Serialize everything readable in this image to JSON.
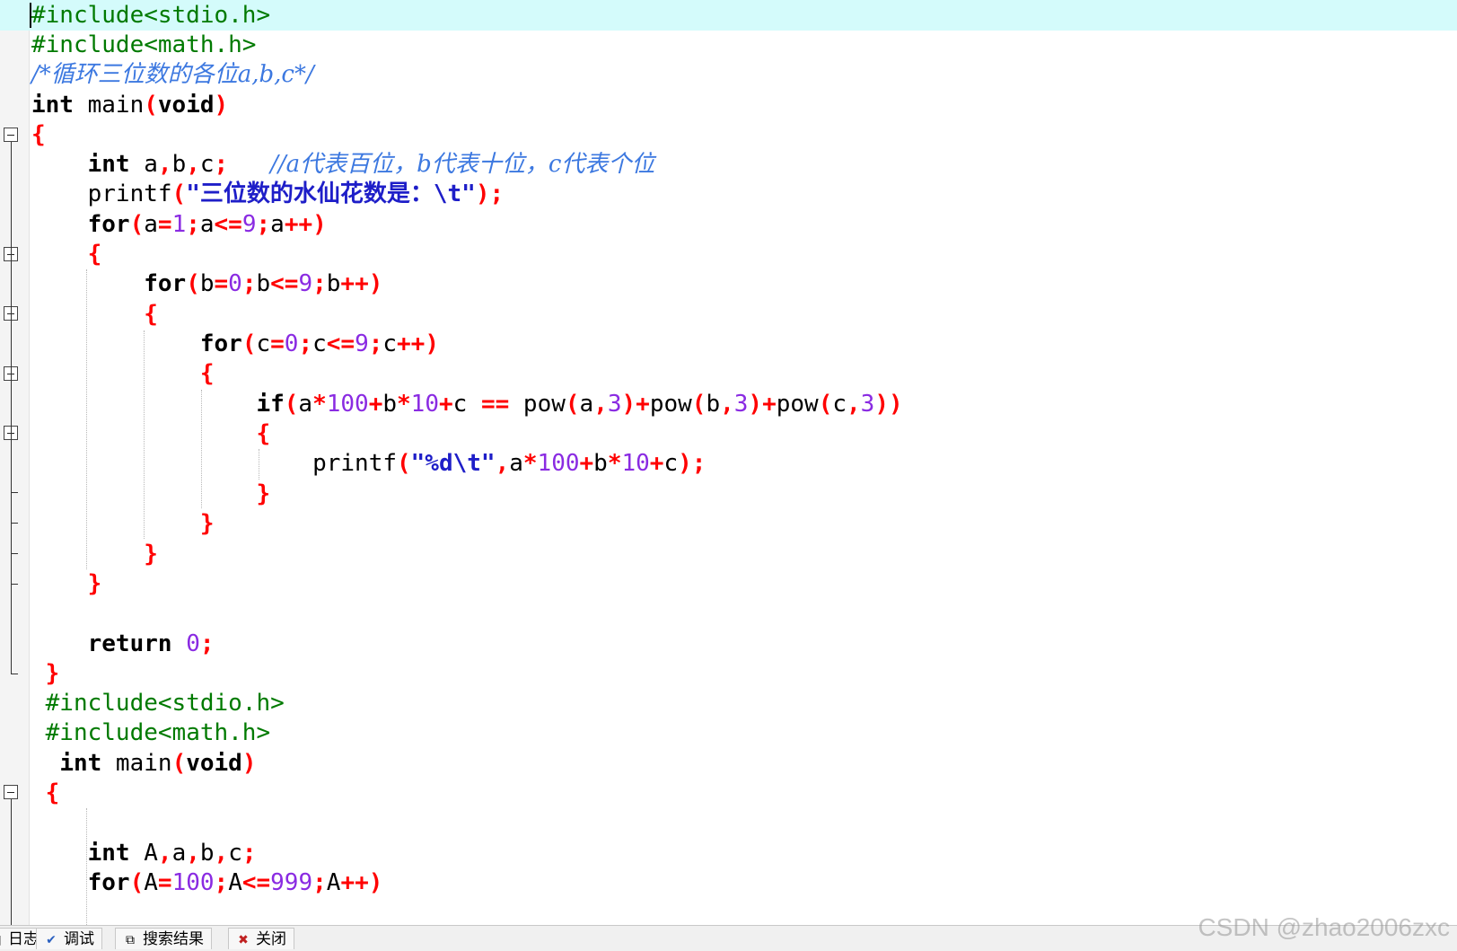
{
  "colors": {
    "preprocessor": "#007a00",
    "keyword": "#000000",
    "comment": "#3c78e0",
    "string": "#1e1ec8",
    "number": "#8a2be2",
    "operator": "#ff0000",
    "current_line": "#d4fbfb"
  },
  "editor": {
    "current_line_index": 0,
    "lines": [
      {
        "tokens": [
          {
            "t": "#include<stdio.h>",
            "c": "pp"
          }
        ]
      },
      {
        "tokens": [
          {
            "t": "#include<math.h>",
            "c": "pp"
          }
        ]
      },
      {
        "tokens": [
          {
            "t": "/*循环三位数的各位a,b,c*/",
            "c": "cm"
          }
        ]
      },
      {
        "tokens": [
          {
            "t": "int",
            "c": "kw"
          },
          {
            "t": " main",
            "c": "id"
          },
          {
            "t": "(",
            "c": "op"
          },
          {
            "t": "void",
            "c": "kw"
          },
          {
            "t": ")",
            "c": "op"
          }
        ]
      },
      {
        "tokens": [
          {
            "t": "{",
            "c": "op"
          }
        ]
      },
      {
        "tokens": [
          {
            "t": "    ",
            "c": "ws"
          },
          {
            "t": "int",
            "c": "kw"
          },
          {
            "t": " a",
            "c": "id"
          },
          {
            "t": ",",
            "c": "op"
          },
          {
            "t": "b",
            "c": "id"
          },
          {
            "t": ",",
            "c": "op"
          },
          {
            "t": "c",
            "c": "id"
          },
          {
            "t": ";",
            "c": "op"
          },
          {
            "t": "   ",
            "c": "ws"
          },
          {
            "t": "//a代表百位，b代表十位，c代表个位",
            "c": "cm"
          }
        ]
      },
      {
        "tokens": [
          {
            "t": "    ",
            "c": "ws"
          },
          {
            "t": "printf",
            "c": "id"
          },
          {
            "t": "(",
            "c": "op"
          },
          {
            "t": "\"三位数的水仙花数是：\\t\"",
            "c": "str"
          },
          {
            "t": ");",
            "c": "op"
          }
        ]
      },
      {
        "tokens": [
          {
            "t": "    ",
            "c": "ws"
          },
          {
            "t": "for",
            "c": "kw"
          },
          {
            "t": "(",
            "c": "op"
          },
          {
            "t": "a",
            "c": "id"
          },
          {
            "t": "=",
            "c": "op"
          },
          {
            "t": "1",
            "c": "num"
          },
          {
            "t": ";",
            "c": "op"
          },
          {
            "t": "a",
            "c": "id"
          },
          {
            "t": "<=",
            "c": "op"
          },
          {
            "t": "9",
            "c": "num"
          },
          {
            "t": ";",
            "c": "op"
          },
          {
            "t": "a",
            "c": "id"
          },
          {
            "t": "++)",
            "c": "op"
          }
        ]
      },
      {
        "tokens": [
          {
            "t": "    ",
            "c": "ws"
          },
          {
            "t": "{",
            "c": "op"
          }
        ]
      },
      {
        "tokens": [
          {
            "t": "        ",
            "c": "ws"
          },
          {
            "t": "for",
            "c": "kw"
          },
          {
            "t": "(",
            "c": "op"
          },
          {
            "t": "b",
            "c": "id"
          },
          {
            "t": "=",
            "c": "op"
          },
          {
            "t": "0",
            "c": "num"
          },
          {
            "t": ";",
            "c": "op"
          },
          {
            "t": "b",
            "c": "id"
          },
          {
            "t": "<=",
            "c": "op"
          },
          {
            "t": "9",
            "c": "num"
          },
          {
            "t": ";",
            "c": "op"
          },
          {
            "t": "b",
            "c": "id"
          },
          {
            "t": "++)",
            "c": "op"
          }
        ]
      },
      {
        "tokens": [
          {
            "t": "        ",
            "c": "ws"
          },
          {
            "t": "{",
            "c": "op"
          }
        ]
      },
      {
        "tokens": [
          {
            "t": "            ",
            "c": "ws"
          },
          {
            "t": "for",
            "c": "kw"
          },
          {
            "t": "(",
            "c": "op"
          },
          {
            "t": "c",
            "c": "id"
          },
          {
            "t": "=",
            "c": "op"
          },
          {
            "t": "0",
            "c": "num"
          },
          {
            "t": ";",
            "c": "op"
          },
          {
            "t": "c",
            "c": "id"
          },
          {
            "t": "<=",
            "c": "op"
          },
          {
            "t": "9",
            "c": "num"
          },
          {
            "t": ";",
            "c": "op"
          },
          {
            "t": "c",
            "c": "id"
          },
          {
            "t": "++)",
            "c": "op"
          }
        ]
      },
      {
        "tokens": [
          {
            "t": "            ",
            "c": "ws"
          },
          {
            "t": "{",
            "c": "op"
          }
        ]
      },
      {
        "tokens": [
          {
            "t": "                ",
            "c": "ws"
          },
          {
            "t": "if",
            "c": "kw"
          },
          {
            "t": "(",
            "c": "op"
          },
          {
            "t": "a",
            "c": "id"
          },
          {
            "t": "*",
            "c": "op"
          },
          {
            "t": "100",
            "c": "num"
          },
          {
            "t": "+",
            "c": "op"
          },
          {
            "t": "b",
            "c": "id"
          },
          {
            "t": "*",
            "c": "op"
          },
          {
            "t": "10",
            "c": "num"
          },
          {
            "t": "+",
            "c": "op"
          },
          {
            "t": "c ",
            "c": "id"
          },
          {
            "t": "==",
            "c": "op"
          },
          {
            "t": " pow",
            "c": "id"
          },
          {
            "t": "(",
            "c": "op"
          },
          {
            "t": "a",
            "c": "id"
          },
          {
            "t": ",",
            "c": "op"
          },
          {
            "t": "3",
            "c": "num"
          },
          {
            "t": ")+",
            "c": "op"
          },
          {
            "t": "pow",
            "c": "id"
          },
          {
            "t": "(",
            "c": "op"
          },
          {
            "t": "b",
            "c": "id"
          },
          {
            "t": ",",
            "c": "op"
          },
          {
            "t": "3",
            "c": "num"
          },
          {
            "t": ")+",
            "c": "op"
          },
          {
            "t": "pow",
            "c": "id"
          },
          {
            "t": "(",
            "c": "op"
          },
          {
            "t": "c",
            "c": "id"
          },
          {
            "t": ",",
            "c": "op"
          },
          {
            "t": "3",
            "c": "num"
          },
          {
            "t": "))",
            "c": "op"
          }
        ]
      },
      {
        "tokens": [
          {
            "t": "                ",
            "c": "ws"
          },
          {
            "t": "{",
            "c": "op"
          }
        ]
      },
      {
        "tokens": [
          {
            "t": "                    ",
            "c": "ws"
          },
          {
            "t": "printf",
            "c": "id"
          },
          {
            "t": "(",
            "c": "op"
          },
          {
            "t": "\"%d\\t\"",
            "c": "str"
          },
          {
            "t": ",",
            "c": "op"
          },
          {
            "t": "a",
            "c": "id"
          },
          {
            "t": "*",
            "c": "op"
          },
          {
            "t": "100",
            "c": "num"
          },
          {
            "t": "+",
            "c": "op"
          },
          {
            "t": "b",
            "c": "id"
          },
          {
            "t": "*",
            "c": "op"
          },
          {
            "t": "10",
            "c": "num"
          },
          {
            "t": "+",
            "c": "op"
          },
          {
            "t": "c",
            "c": "id"
          },
          {
            "t": ");",
            "c": "op"
          }
        ]
      },
      {
        "tokens": [
          {
            "t": "                ",
            "c": "ws"
          },
          {
            "t": "}",
            "c": "op"
          }
        ]
      },
      {
        "tokens": [
          {
            "t": "            ",
            "c": "ws"
          },
          {
            "t": "}",
            "c": "op"
          }
        ]
      },
      {
        "tokens": [
          {
            "t": "        ",
            "c": "ws"
          },
          {
            "t": "}",
            "c": "op"
          }
        ]
      },
      {
        "tokens": [
          {
            "t": "    ",
            "c": "ws"
          },
          {
            "t": "}",
            "c": "op"
          }
        ]
      },
      {
        "tokens": []
      },
      {
        "tokens": [
          {
            "t": "    ",
            "c": "ws"
          },
          {
            "t": "return",
            "c": "kw"
          },
          {
            "t": " ",
            "c": "ws"
          },
          {
            "t": "0",
            "c": "num"
          },
          {
            "t": ";",
            "c": "op"
          }
        ]
      },
      {
        "tokens": [
          {
            "t": " ",
            "c": "ws"
          },
          {
            "t": "}",
            "c": "op"
          }
        ]
      },
      {
        "tokens": [
          {
            "t": " ",
            "c": "ws"
          },
          {
            "t": "#include<stdio.h>",
            "c": "pp"
          }
        ]
      },
      {
        "tokens": [
          {
            "t": " ",
            "c": "ws"
          },
          {
            "t": "#include<math.h>",
            "c": "pp"
          }
        ]
      },
      {
        "tokens": [
          {
            "t": "  ",
            "c": "ws"
          },
          {
            "t": "int",
            "c": "kw"
          },
          {
            "t": " main",
            "c": "id"
          },
          {
            "t": "(",
            "c": "op"
          },
          {
            "t": "void",
            "c": "kw"
          },
          {
            "t": ")",
            "c": "op"
          }
        ]
      },
      {
        "tokens": [
          {
            "t": " ",
            "c": "ws"
          },
          {
            "t": "{",
            "c": "op"
          }
        ]
      },
      {
        "tokens": []
      },
      {
        "tokens": [
          {
            "t": "    ",
            "c": "ws"
          },
          {
            "t": "int",
            "c": "kw"
          },
          {
            "t": " A",
            "c": "id"
          },
          {
            "t": ",",
            "c": "op"
          },
          {
            "t": "a",
            "c": "id"
          },
          {
            "t": ",",
            "c": "op"
          },
          {
            "t": "b",
            "c": "id"
          },
          {
            "t": ",",
            "c": "op"
          },
          {
            "t": "c",
            "c": "id"
          },
          {
            "t": ";",
            "c": "op"
          }
        ]
      },
      {
        "tokens": [
          {
            "t": "    ",
            "c": "ws"
          },
          {
            "t": "for",
            "c": "kw"
          },
          {
            "t": "(",
            "c": "op"
          },
          {
            "t": "A",
            "c": "id"
          },
          {
            "t": "=",
            "c": "op"
          },
          {
            "t": "100",
            "c": "num"
          },
          {
            "t": ";",
            "c": "op"
          },
          {
            "t": "A",
            "c": "id"
          },
          {
            "t": "<=",
            "c": "op"
          },
          {
            "t": "999",
            "c": "num"
          },
          {
            "t": ";",
            "c": "op"
          },
          {
            "t": "A",
            "c": "id"
          },
          {
            "t": "++)",
            "c": "op"
          }
        ]
      }
    ]
  },
  "bottom_tabs": [
    {
      "label": "日志",
      "icon": "log-icon"
    },
    {
      "label": "调试",
      "icon": "debug-check-icon"
    },
    {
      "label": "搜索结果",
      "icon": "search-results-icon"
    },
    {
      "label": "关闭",
      "icon": "close-icon"
    }
  ],
  "watermark": "CSDN @zhao2006zxc"
}
